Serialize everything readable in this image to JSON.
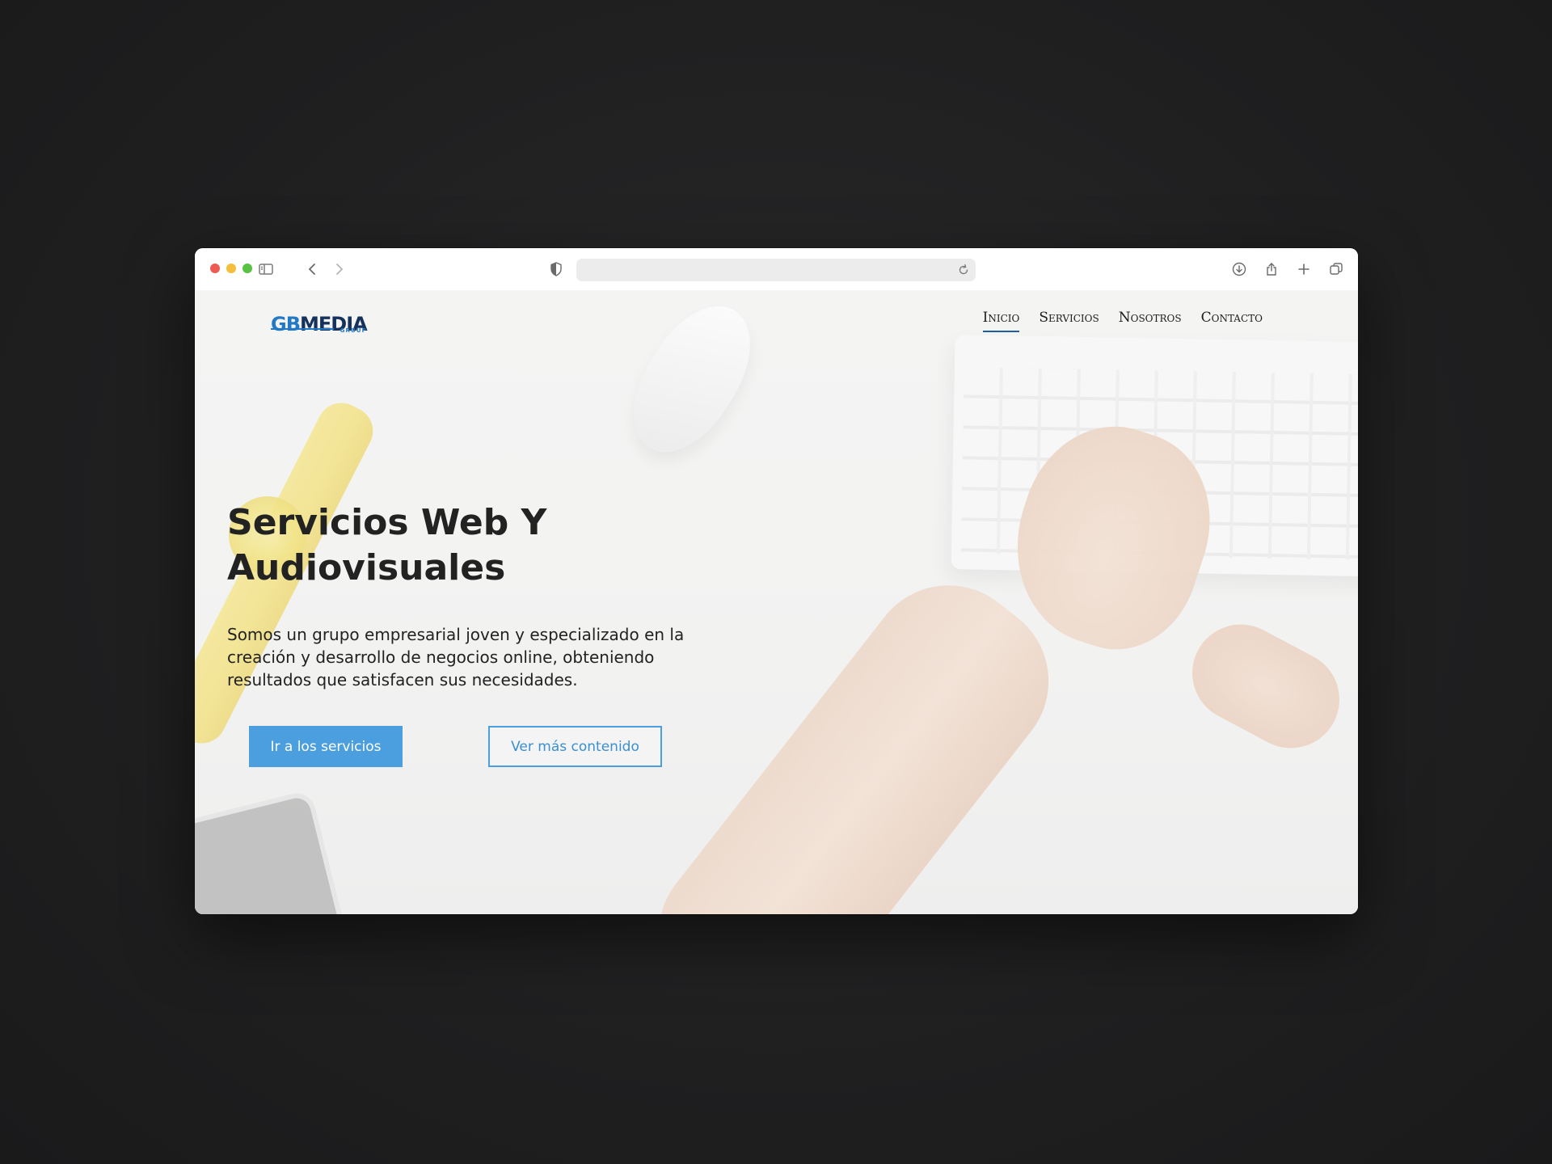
{
  "browser": {
    "icons": {
      "sidebar": "sidebar-icon",
      "back": "chevron-left-icon",
      "forward": "chevron-right-icon",
      "shield": "shield-icon",
      "reload": "reload-icon",
      "download": "download-icon",
      "share": "share-icon",
      "new_tab": "plus-icon",
      "tabs": "tabs-overview-icon"
    },
    "url": ""
  },
  "site": {
    "logo": {
      "gb": "GB",
      "media": "MEDIA",
      "group": "GROUP"
    },
    "nav": [
      {
        "label": "Inicio",
        "active": true
      },
      {
        "label": "Servicios",
        "active": false
      },
      {
        "label": "Nosotros",
        "active": false
      },
      {
        "label": "Contacto",
        "active": false
      }
    ],
    "hero": {
      "title": "Servicios Web Y Audiovisuales",
      "text": "Somos un grupo empresarial joven y especializado en la creación y desarrollo de negocios online, obteniendo resultados que satisfacen sus necesidades.",
      "primary_button": "Ir a los servicios",
      "secondary_button": "Ver más contenido"
    }
  },
  "colors": {
    "accent": "#4b9fdf",
    "logo_blue": "#2379c6",
    "logo_navy": "#16325c",
    "text": "#222222",
    "background": "#1f1f20"
  }
}
